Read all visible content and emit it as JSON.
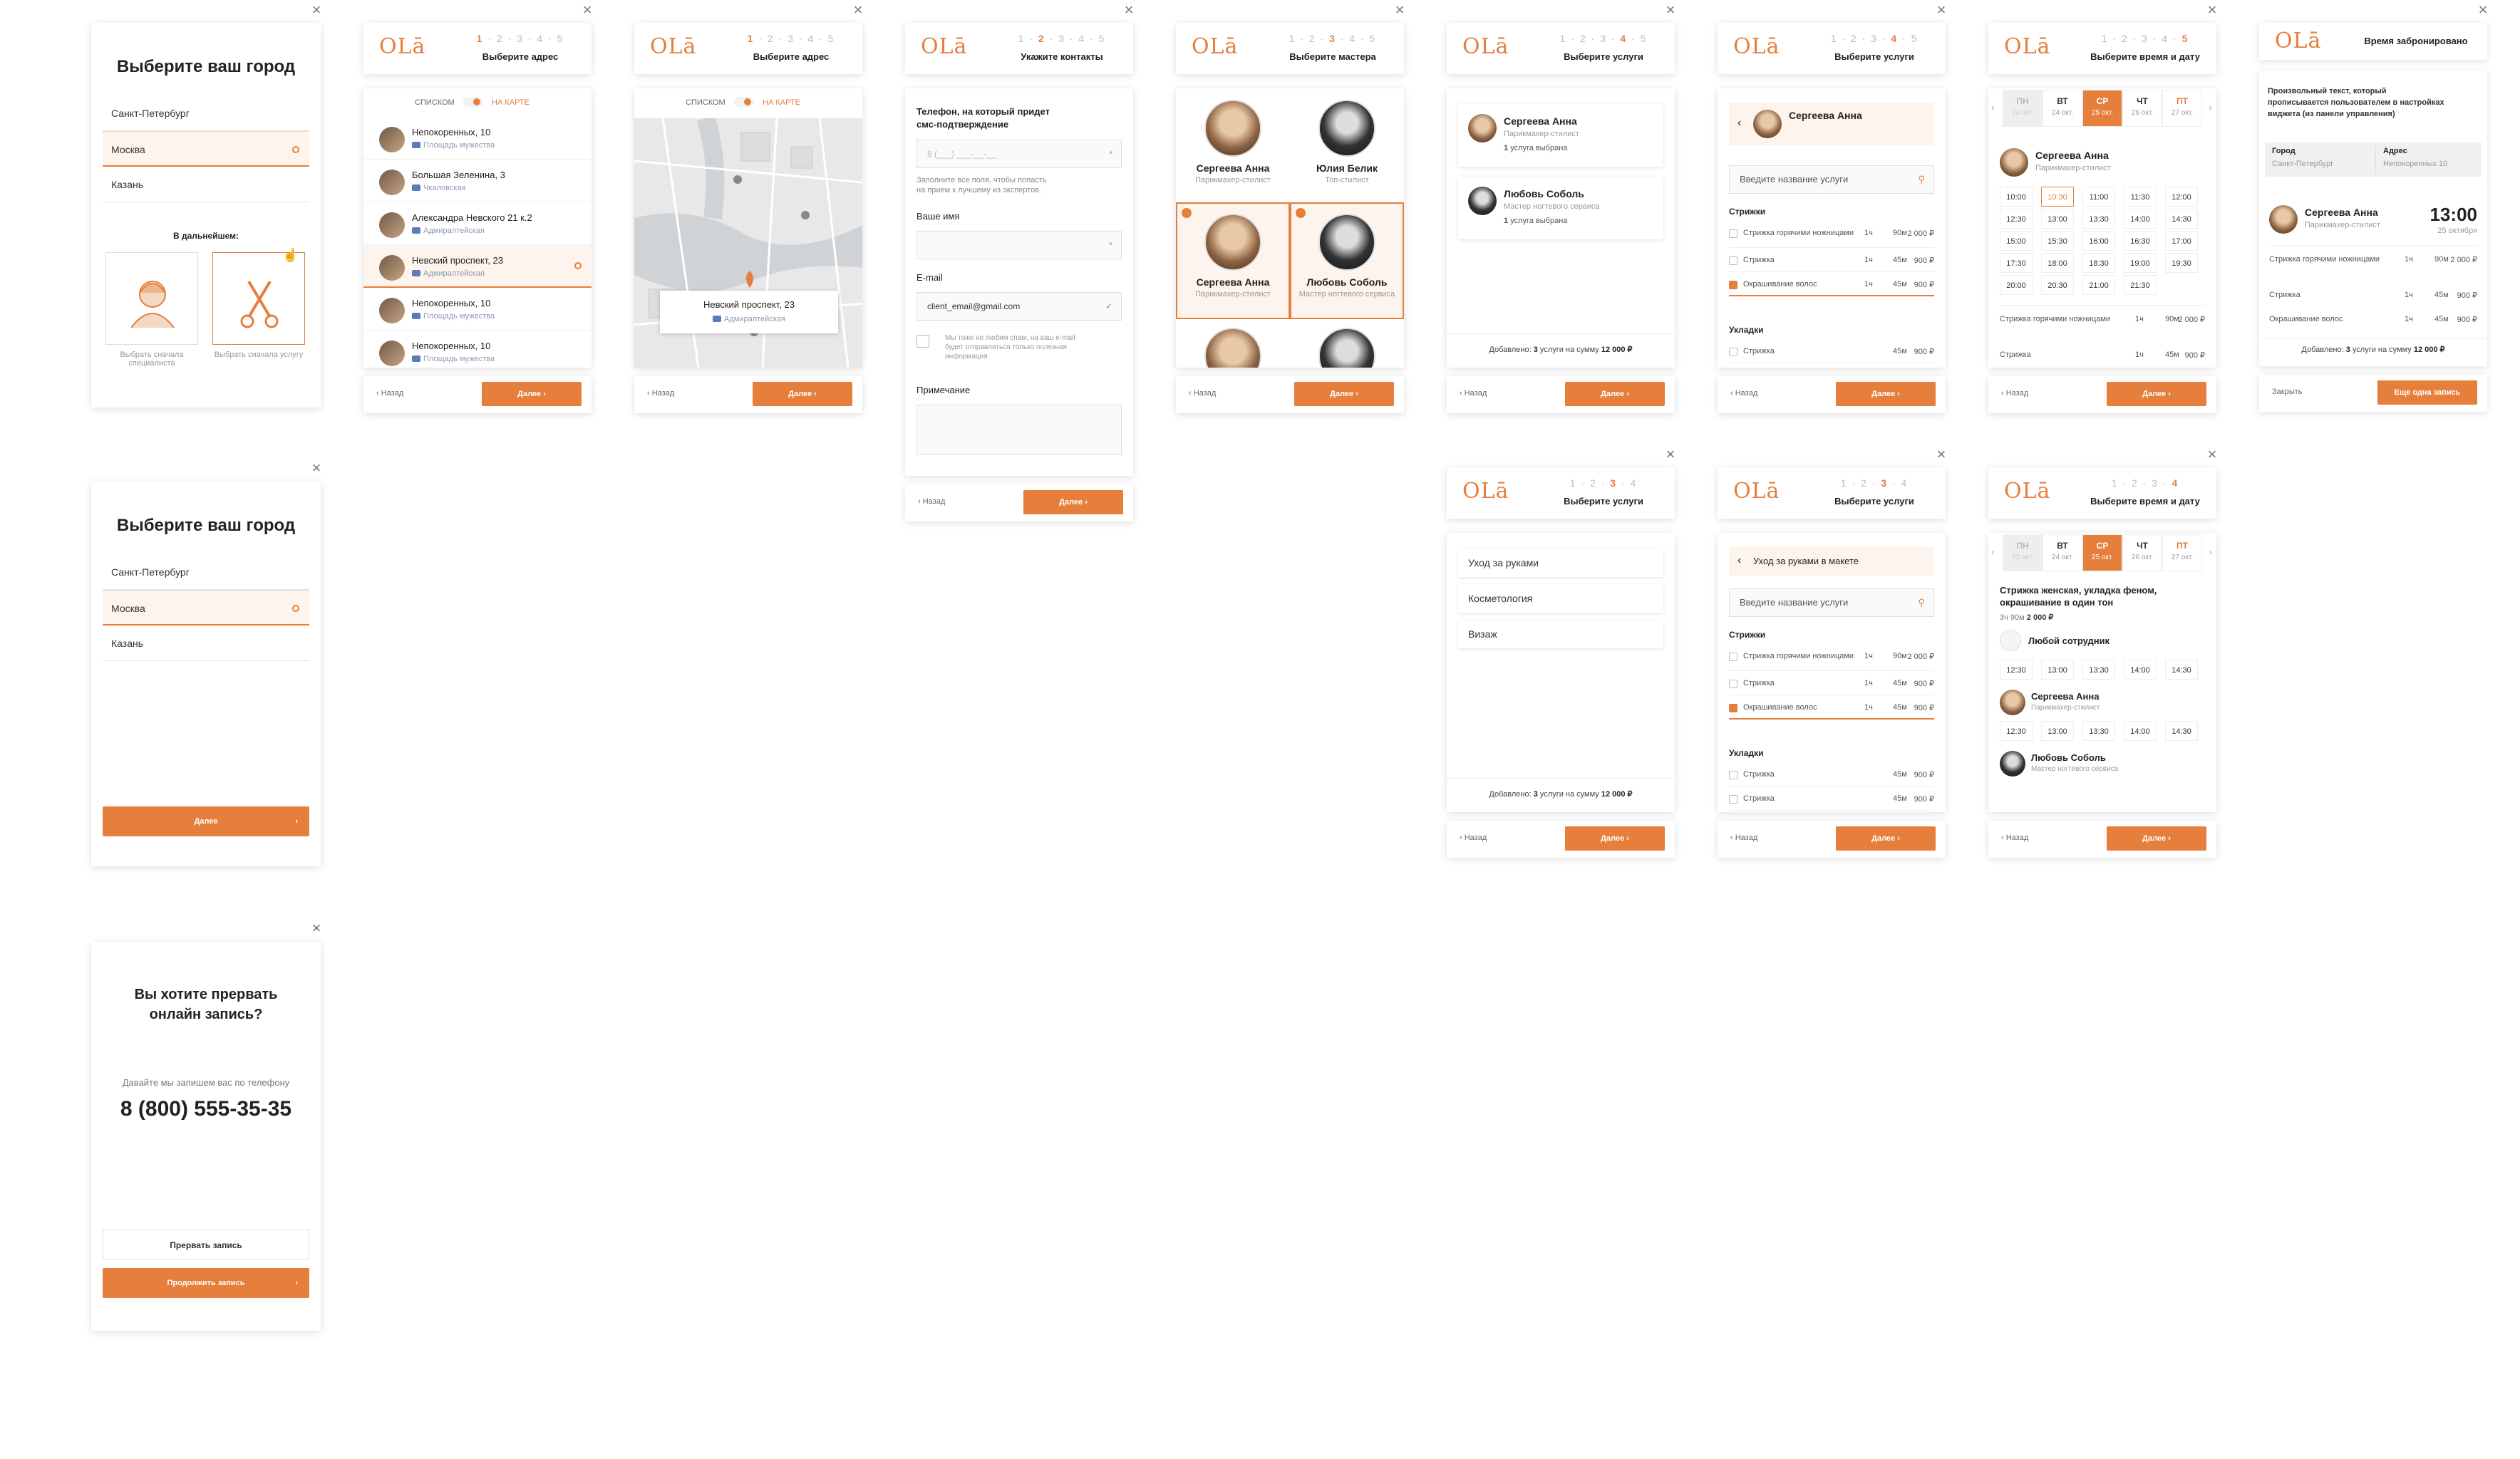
{
  "common": {
    "next_label": "Далее",
    "back_label": "Назад",
    "logo": "OLā",
    "close": "×",
    "chevron_right": "›",
    "chevron_left": "‹",
    "search_icon": "⚲",
    "plus_icon": "+",
    "radio_dot": "",
    "accent_color": "#e67e3c"
  },
  "city_screen": {
    "title": "Выберите ваш город",
    "cities": [
      "Санкт-Петербург",
      "Москва",
      "Казань"
    ],
    "selected_index": 1,
    "later_label": "В дальнейшем:",
    "option_specialist": "Выбрать сначала специалиста",
    "option_service": "Выбрать сначала услугу"
  },
  "city_screen_2": {
    "title": "Выберите ваш город",
    "cities": [
      "Санкт-Петербург",
      "Москва",
      "Казань"
    ],
    "next_label": "Далее"
  },
  "interrupt_screen": {
    "title_line1": "Вы хотите прервать",
    "title_line2": "онлайн запись?",
    "subtitle": "Давайте мы запишем вас по телефону",
    "phone": "8 (800) 555-35-35",
    "stop_label": "Прервать запись",
    "continue_label": "Продолжить запись"
  },
  "address_list": {
    "steps": [
      "1",
      "2",
      "3",
      "4",
      "5"
    ],
    "title": "Выберите адрес",
    "toggle_list": "СПИСКОМ",
    "toggle_map": "НА КАРТЕ",
    "rows": [
      {
        "street": "Непокоренных, 10",
        "metro": "Площадь мужества"
      },
      {
        "street": "Большая Зеленина, 3",
        "metro": "Чкаловская"
      },
      {
        "street": "Александра Невского 21 к.2",
        "metro": "Адмиралтейская"
      },
      {
        "street": "Невский проспект, 23",
        "metro": "Адмиралтейская"
      },
      {
        "street": "Непокоренных, 10",
        "metro": "Площадь мужества"
      },
      {
        "street": "Непокоренных, 10",
        "metro": "Площадь мужества"
      }
    ]
  },
  "address_map": {
    "title": "Выберите адрес",
    "toggle_list": "СПИСКОМ",
    "toggle_map": "НА КАРТЕ",
    "popup_street": "Невский проспект, 23",
    "popup_metro": "Адмиралтейская"
  },
  "contacts": {
    "title": "Укажите контакты",
    "phone_label_1": "Телефон, на который придет",
    "phone_label_2": "смс-подтверждение",
    "phone_placeholder": "8 (___) ___-__-__",
    "hint_1": "Заполните все поля, чтобы попасть",
    "hint_2": "на прием к лучшему из экспертов.",
    "name_label": "Ваше имя",
    "email_label": "E-mail",
    "email_value": "client_email@gmail.com",
    "spam_1": "Мы тоже не любим спам, на ваш e-mail",
    "spam_2": "будет отправляться только полезная",
    "spam_3": "информация",
    "note_label": "Примечание"
  },
  "masters": {
    "title": "Выберите мастера",
    "list": [
      {
        "name": "Сергеева Анна",
        "role": "Парикмахер-стилист"
      },
      {
        "name": "Юлия Белик",
        "role": "Топ-стилист"
      },
      {
        "name": "Сергеева Анна",
        "role": "Парикмахер-стилист"
      },
      {
        "name": "Любовь Соболь",
        "role": "Мастер ногтевого сервиса"
      }
    ]
  },
  "services_by_master": {
    "title": "Выберите услуги",
    "cards": [
      {
        "name": "Сергеева Анна",
        "role": "Парикмахер-стилист",
        "extra_count": "1",
        "extra": "услуга выбрана"
      },
      {
        "name": "Любовь Соболь",
        "role": "Мастер ногтевого сервиса",
        "extra_count": "1",
        "extra": "услуга выбрана"
      }
    ],
    "sum_prefix": "Добавлено:",
    "sum_count": "3",
    "sum_mid": "услуги на сумму",
    "sum_value": "12 000 ₽"
  },
  "services_list": {
    "title": "Выберите услуги",
    "master_name": "Сергеева Анна",
    "search_placeholder": "Введите название услуги",
    "sections": [
      {
        "title": "Стрижки",
        "items": [
          {
            "name": "Стрижка горячими ножницами",
            "d1": "1ч",
            "d2": "90м",
            "price": "2 000 ₽",
            "checked": false
          },
          {
            "name": "Стрижка",
            "d1": "1ч",
            "d2": "45м",
            "price": "900 ₽",
            "checked": false
          },
          {
            "name": "Окрашивание волос",
            "d1": "1ч",
            "d2": "45м",
            "price": "900 ₽",
            "checked": true
          }
        ]
      },
      {
        "title": "Укладки",
        "items": [
          {
            "name": "Стрижка",
            "d1": "",
            "d2": "45м",
            "price": "900 ₽",
            "checked": false
          }
        ]
      }
    ]
  },
  "datetime": {
    "title": "Выберите время и дату",
    "days": [
      {
        "d": "ПН",
        "date": "23 окт."
      },
      {
        "d": "ВТ",
        "date": "24 окт."
      },
      {
        "d": "СР",
        "date": "25 окт."
      },
      {
        "d": "ЧТ",
        "date": "26 окт."
      },
      {
        "d": "ПТ",
        "date": "27 окт."
      }
    ],
    "master_name": "Сергеева Анна",
    "master_role": "Парикмахер-стилист",
    "times": [
      "10:00",
      "10:30",
      "11:00",
      "11:30",
      "12:00",
      "12:30",
      "13:00",
      "13:30",
      "14:00",
      "14:30",
      "15:00",
      "15:30",
      "16:00",
      "16:30",
      "17:00",
      "17:30",
      "18:00",
      "18:30",
      "19:00",
      "19:30",
      "20:00",
      "20:30",
      "21:00",
      "21:30"
    ],
    "svc_rows": [
      {
        "name": "Стрижка горячими ножницами",
        "d1": "1ч",
        "d2": "90м",
        "price": "2 000 ₽"
      },
      {
        "name": "Стрижка",
        "d1": "1ч",
        "d2": "45м",
        "price": "900 ₽"
      }
    ]
  },
  "booked": {
    "title": "Время забронировано",
    "text_1": "Произвольный текст, который",
    "text_2": "прописывается пользователем в настройках",
    "text_3": "виджета (из панели управления)",
    "city_label": "Город",
    "city_value": "Санкт-Петербург",
    "addr_label": "Адрес",
    "addr_value": "Непокоренных 10",
    "master_name": "Сергеева Анна",
    "master_role": "Парикмахер-стилист",
    "time": "13:00",
    "date": "25 октября",
    "rows": [
      {
        "name": "Стрижка горячими ножницами",
        "d1": "1ч",
        "d2": "90м",
        "price": "2 000 ₽"
      },
      {
        "name": "Стрижка",
        "d1": "1ч",
        "d2": "45м",
        "price": "900 ₽"
      },
      {
        "name": "Окрашивание волос",
        "d1": "1ч",
        "d2": "45м",
        "price": "900 ₽"
      }
    ],
    "close_label": "Закрыть",
    "more_label": "Еще одна запись"
  },
  "categories": {
    "steps": [
      "1",
      "2",
      "3",
      "4"
    ],
    "title": "Выберите услуги",
    "items": [
      "Уход за руками",
      "Косметология",
      "Визаж"
    ]
  },
  "services_list_2": {
    "back_to": "Уход за руками в макете"
  },
  "datetime_2": {
    "service_title_1": "Стрижка женская, укладка феном,",
    "service_title_2": "окрашивание в один тон",
    "d1": "3ч",
    "d2": "90м",
    "price": "2 000 ₽",
    "any_label": "Любой сотрудник",
    "masters": [
      {
        "name": "Сергеева Анна",
        "role": "Парикмахер-стилист"
      },
      {
        "name": "Любовь Соболь",
        "role": "Мастер ногтевого сервиса"
      }
    ],
    "row_times": [
      "12:30",
      "13:00",
      "13:30",
      "14:00",
      "14:30"
    ]
  }
}
